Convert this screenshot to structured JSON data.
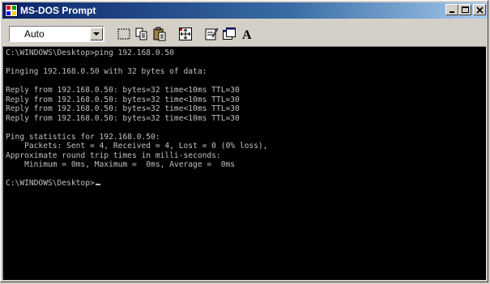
{
  "window": {
    "title": "MS-DOS Prompt",
    "icon": "msdos-icon",
    "controls": {
      "minimize": "minimize-icon",
      "maximize": "maximize-icon",
      "close": "close-icon"
    }
  },
  "toolbar": {
    "font_size_value": "Auto",
    "tools": [
      "mark-icon",
      "copy-icon",
      "paste-icon",
      "full-screen-icon",
      "properties-icon",
      "background-icon",
      "font-icon"
    ],
    "font_glyph": "A"
  },
  "console": {
    "lines": [
      "C:\\WINDOWS\\Desktop>ping 192.168.0.50",
      "",
      "Pinging 192.168.0.50 with 32 bytes of data:",
      "",
      "Reply from 192.168.0.50: bytes=32 time<10ms TTL=30",
      "Reply from 192.168.0.50: bytes=32 time<10ms TTL=30",
      "Reply from 192.168.0.50: bytes=32 time<10ms TTL=30",
      "Reply from 192.168.0.50: bytes=32 time<10ms TTL=30",
      "",
      "Ping statistics for 192.168.0.50:",
      "    Packets: Sent = 4, Received = 4, Lost = 0 (0% loss),",
      "Approximate round trip times in milli-seconds:",
      "    Minimum = 0ms, Maximum =  0ms, Average =  0ms",
      "",
      "C:\\WINDOWS\\Desktop>"
    ],
    "text_color": "#c0c0c0",
    "background_color": "#000000"
  }
}
